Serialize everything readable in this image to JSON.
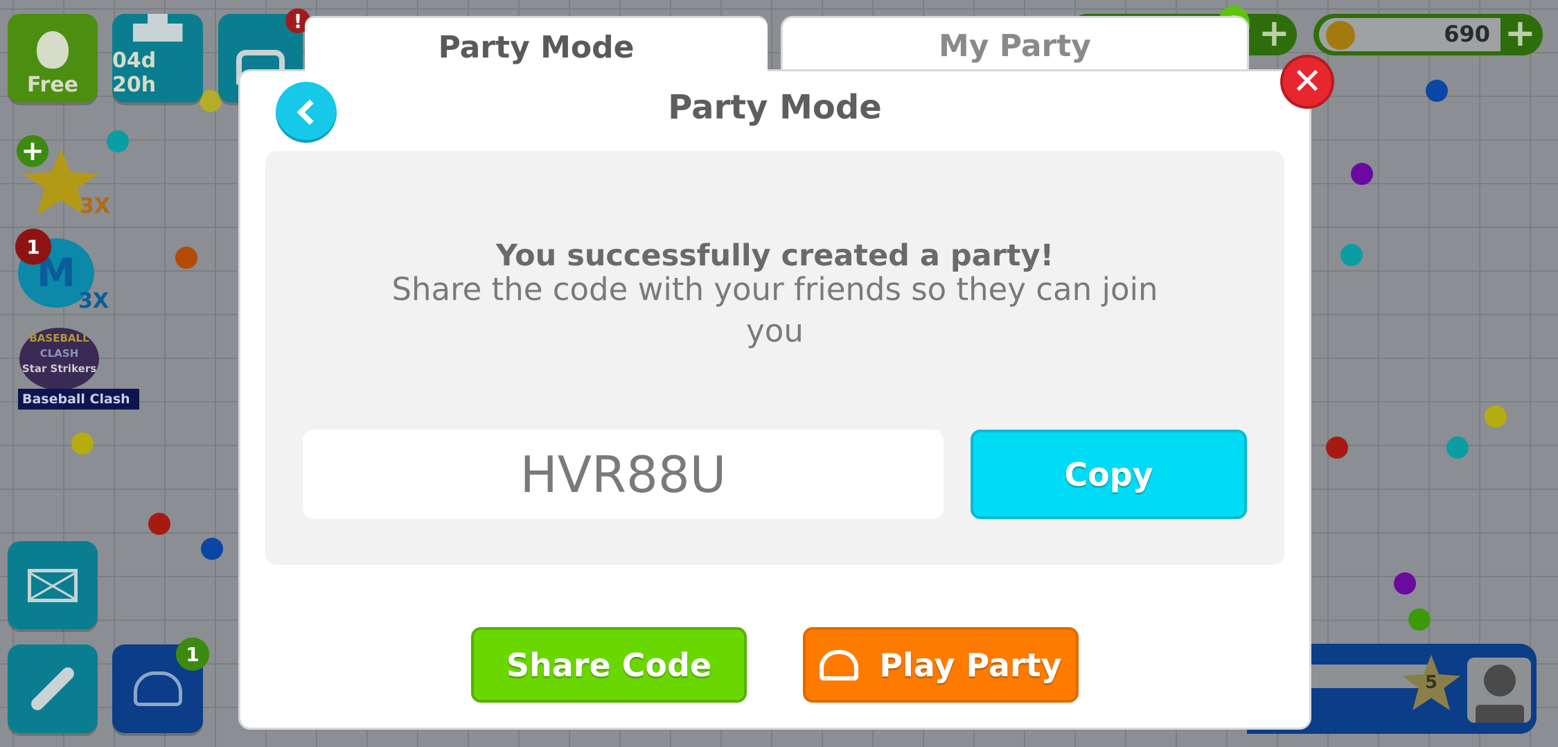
{
  "hud": {
    "free_label": "Free",
    "leaderboard_timer": "04d 20h",
    "chest_alert": "!",
    "boost_star_multiplier": "3X",
    "mass_multiplier": "3X",
    "mass_badge": "1",
    "event_logo_text": [
      "BASEBALL",
      "CLASH",
      "Star Strikers"
    ],
    "event_label": "Baseball Clash",
    "gems_badge": "1",
    "coins": "690",
    "friends_badge": "1",
    "level": "5"
  },
  "tabs": [
    {
      "label": "Party Mode",
      "active": true
    },
    {
      "label": "My Party",
      "active": false
    }
  ],
  "dialog": {
    "title": "Party Mode",
    "success": "You successfully created a party!",
    "instructions": "Share the code with your friends so they can join you",
    "party_code": "HVR88U",
    "copy_label": "Copy",
    "share_label": "Share Code",
    "play_label": "Play Party"
  },
  "colors": {
    "accent_cyan": "#00d4f0",
    "green": "#66d600",
    "orange": "#ff7a00",
    "close_red": "#e8262e"
  }
}
